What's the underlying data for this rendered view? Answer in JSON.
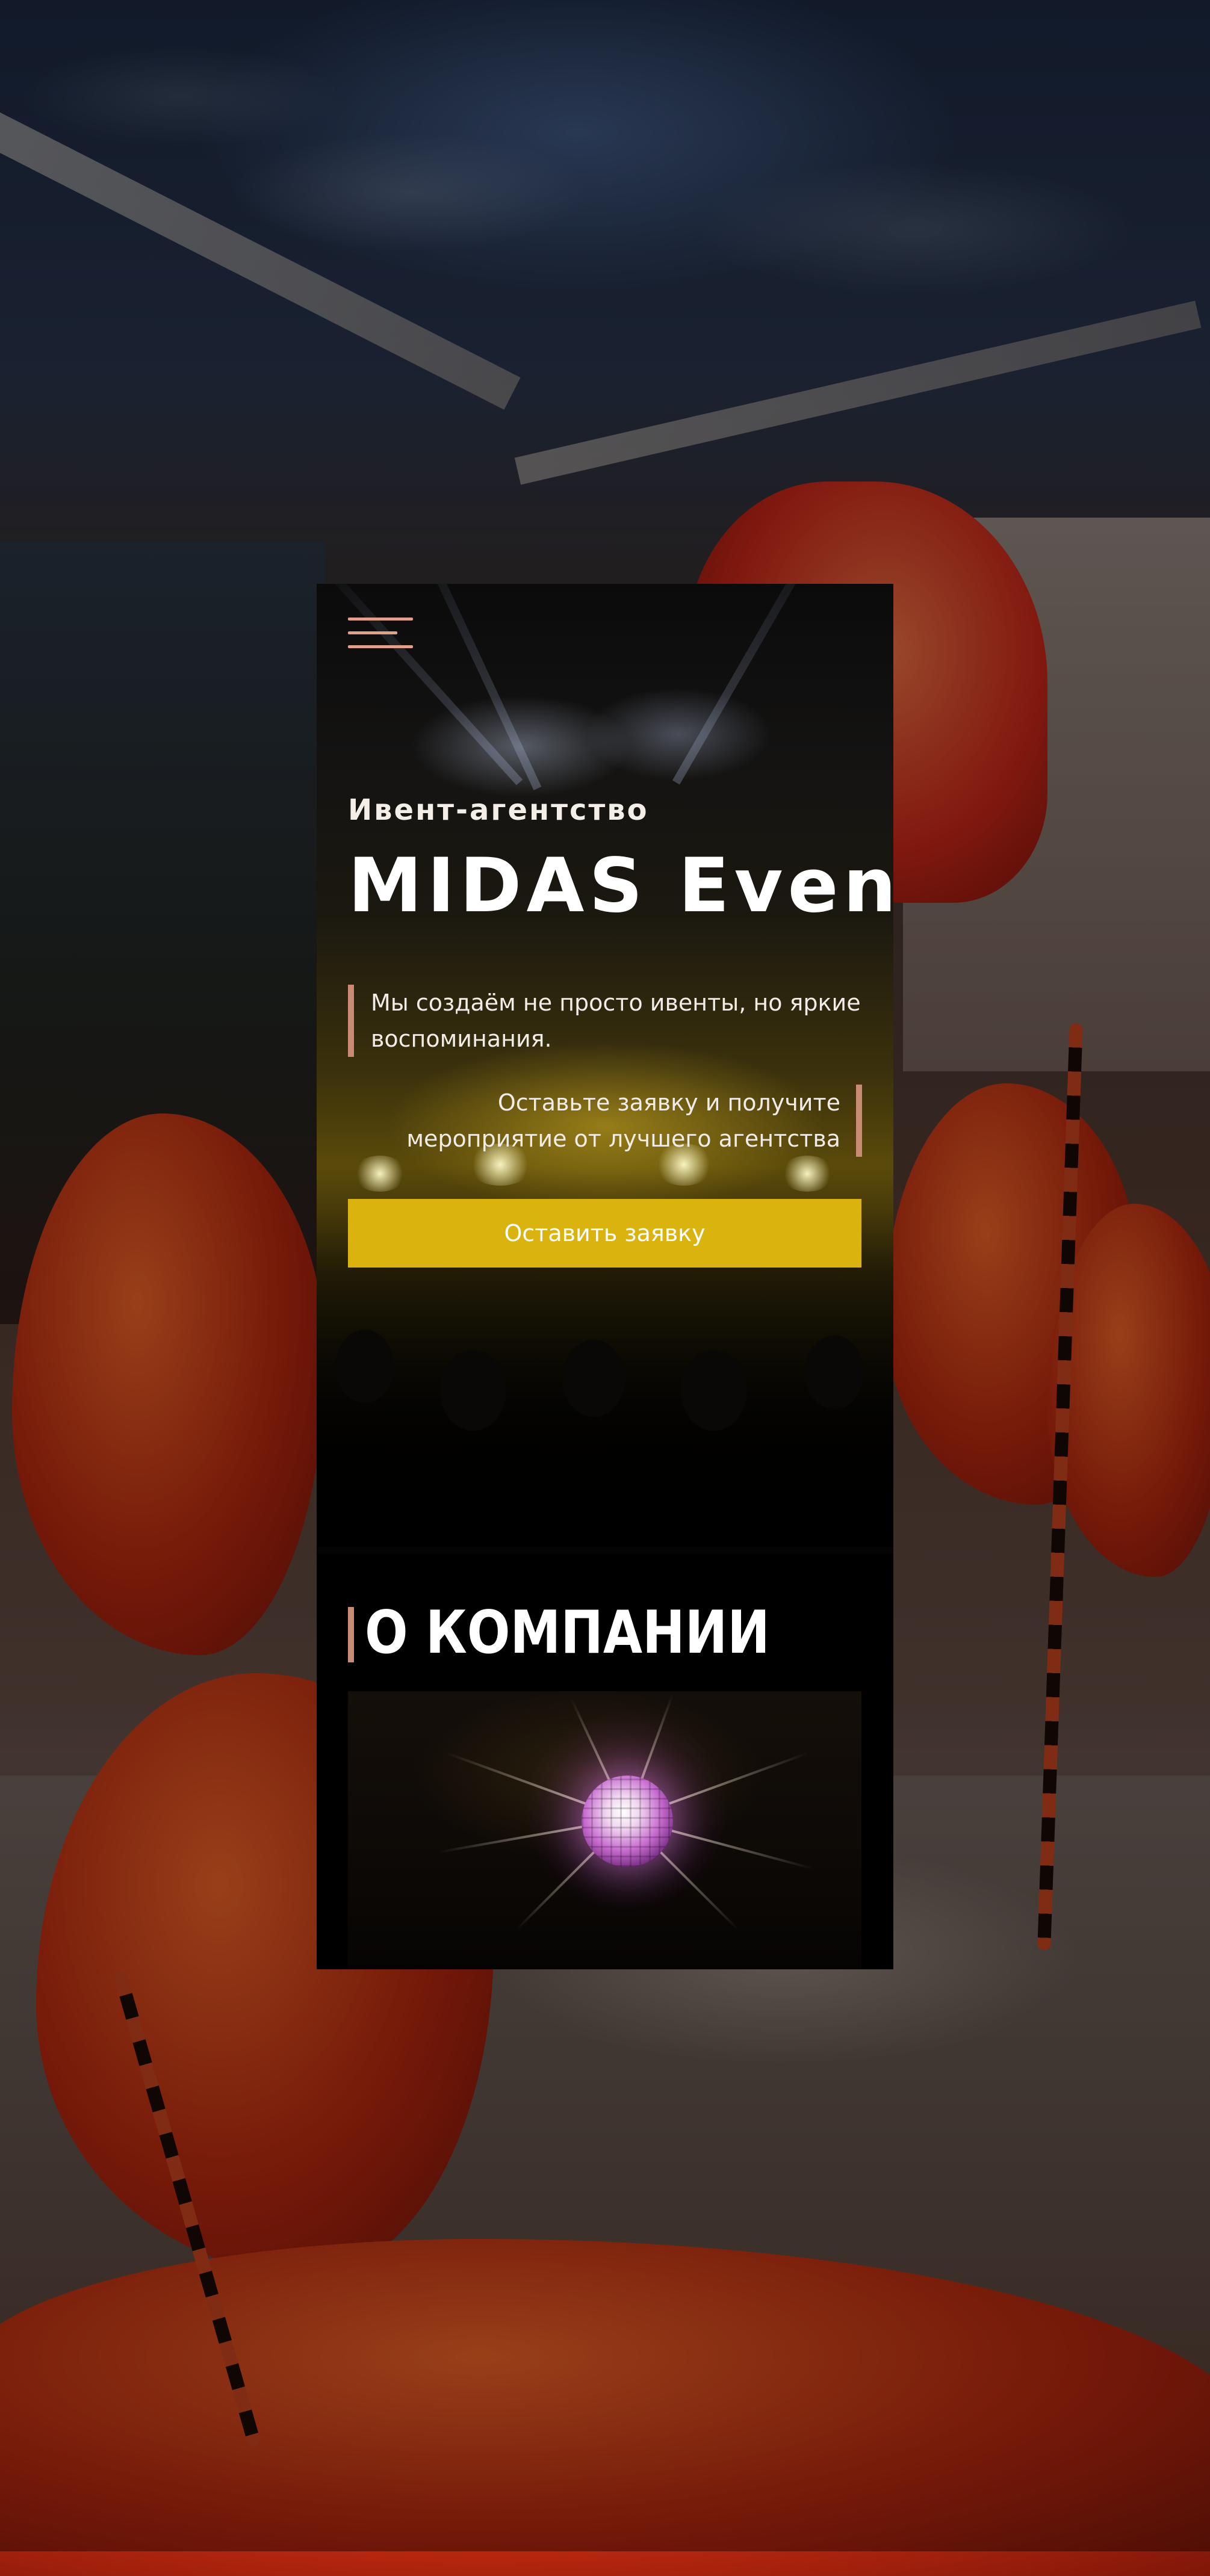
{
  "hero": {
    "eyebrow": "Ивент-агентство",
    "title": "MIDAS Event",
    "lead": "Мы создаём не просто ивенты, но яркие воспоминания.",
    "cta_text": "Оставьте заявку и получите мероприятие от лучшего агентства",
    "cta_button": "Оставить заявку"
  },
  "about": {
    "title": "О КОМПАНИИ"
  },
  "icons": {
    "menu": "burger-menu-icon"
  },
  "colors": {
    "accent": "#c98b74",
    "button": "#dbb30e",
    "panel_bg": "#000000"
  }
}
